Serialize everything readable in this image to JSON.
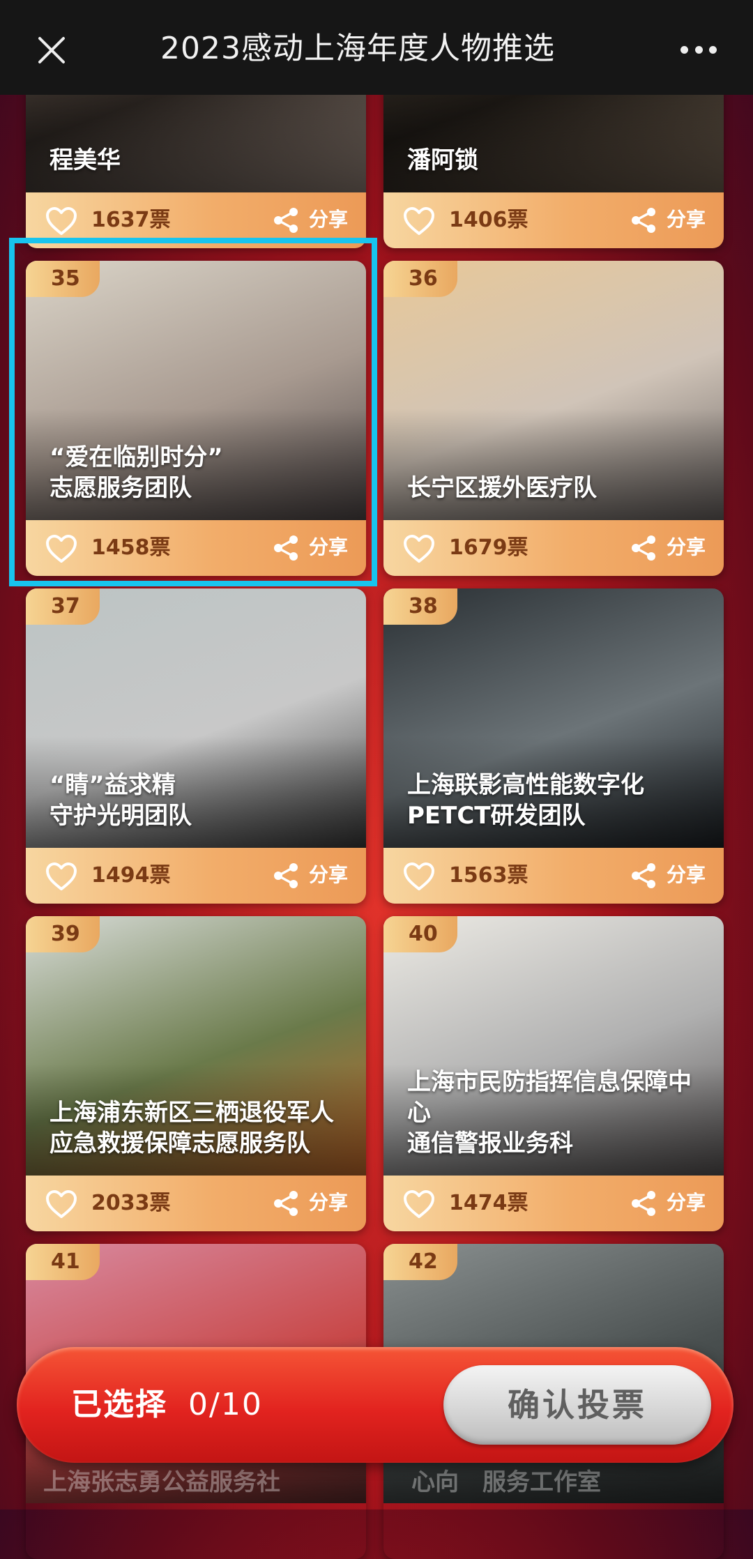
{
  "topbar": {
    "title": "2023感动上海年度人物推选"
  },
  "cards": [
    {
      "number": "",
      "name": "程美华",
      "votes": "1637票",
      "share": "分享",
      "photo": [
        "#6a5a50",
        "#2a2420",
        "#8c7c72"
      ]
    },
    {
      "number": "",
      "name": "潘阿锁",
      "votes": "1406票",
      "share": "分享",
      "photo": [
        "#4a4036",
        "#1c1814",
        "#6e5e4e"
      ]
    },
    {
      "number": "35",
      "name": "“爱在临别时分”\n志愿服务团队",
      "votes": "1458票",
      "share": "分享",
      "photo": [
        "#dad4c8",
        "#a89a90",
        "#504848"
      ]
    },
    {
      "number": "36",
      "name": "长宁区援外医疗队",
      "votes": "1679票",
      "share": "分享",
      "photo": [
        "#e8c898",
        "#d0c4b8",
        "#6a6462"
      ]
    },
    {
      "number": "37",
      "name": "“睛”益求精\n守护光明团队",
      "votes": "1494票",
      "share": "分享",
      "photo": [
        "#bcc4c4",
        "#c8c8c8",
        "#3a3a3a"
      ]
    },
    {
      "number": "38",
      "name": "上海联影高性能数字化\nPETCT研发团队",
      "votes": "1563票",
      "share": "分享",
      "photo": [
        "#2a3034",
        "#6c7478",
        "#1c2024"
      ]
    },
    {
      "number": "39",
      "name": "上海浦东新区三栖退役军人\n应急救援保障志愿服务队",
      "votes": "2033票",
      "share": "分享",
      "photo": [
        "#d8dcd8",
        "#6a7a4a",
        "#c46a2a"
      ]
    },
    {
      "number": "40",
      "name": "上海市民防指挥信息保障中心\n通信警报业务科",
      "votes": "1474票",
      "share": "分享",
      "photo": [
        "#eceae4",
        "#b0b0b0",
        "#585454"
      ]
    },
    {
      "number": "41",
      "name": "",
      "votes": "",
      "share": "",
      "photo": [
        "#d88aa0",
        "#c84848",
        "#5a2a2a"
      ]
    },
    {
      "number": "42",
      "name": "",
      "votes": "",
      "share": "",
      "photo": [
        "#8a9090",
        "#4a5050",
        "#2a2e2e"
      ]
    }
  ],
  "bottom": {
    "selected_label": "已选择",
    "selected_count": "0/10",
    "confirm_label": "确认投票",
    "left_hidden_text": "上海张志勇公益服务社",
    "right_hidden_text": "心向　服务工作室"
  },
  "colors": {
    "accent_frame": "#18c4ee",
    "bar_start": "#f7d6a0",
    "bar_end": "#ec9a57",
    "vote_text": "#7a3a14",
    "bottom_red": "#e2231f"
  }
}
